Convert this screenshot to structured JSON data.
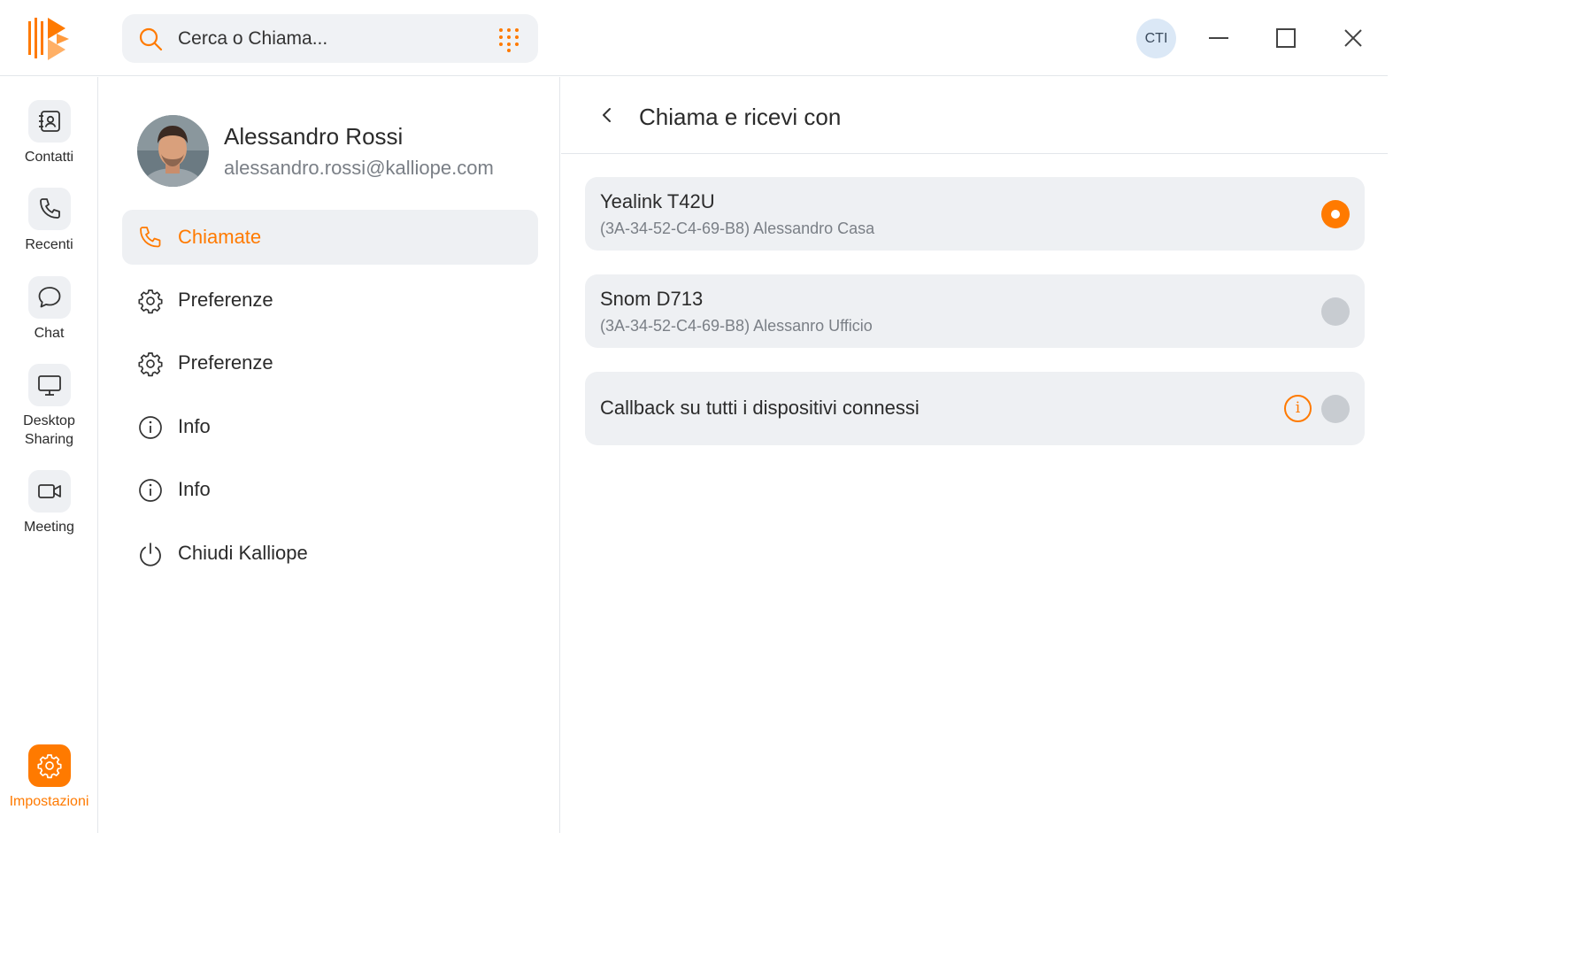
{
  "app": {
    "logo": "kalliope-logo",
    "accent_color": "#ff7a00"
  },
  "search": {
    "placeholder": "Cerca o Chiama...",
    "icon": "search-icon",
    "dialpad_icon": "dialpad-icon"
  },
  "header": {
    "badge": "CTI",
    "window_controls": [
      "minimize-icon",
      "maximize-icon",
      "close-icon"
    ]
  },
  "rail": {
    "items": [
      {
        "label": "Contatti",
        "icon": "contacts-icon"
      },
      {
        "label": "Recenti",
        "icon": "phone-icon"
      },
      {
        "label": "Chat",
        "icon": "chat-bubble-icon"
      },
      {
        "label": "Desktop\nSharing",
        "icon": "monitor-icon"
      },
      {
        "label": "Meeting",
        "icon": "video-camera-icon"
      }
    ],
    "settings": {
      "label": "Impostazioni",
      "icon": "gear-icon",
      "active": true
    }
  },
  "profile": {
    "name": "Alessandro Rossi",
    "email": "alessandro.rossi@kalliope.com"
  },
  "menu": {
    "items": [
      {
        "label": "Chiamate",
        "icon": "phone-icon",
        "active": true
      },
      {
        "label": "Preferenze",
        "icon": "gear-icon"
      },
      {
        "label": "Preferenze",
        "icon": "gear-icon"
      },
      {
        "label": "Info",
        "icon": "info-icon"
      },
      {
        "label": "Info",
        "icon": "info-icon"
      },
      {
        "label": "Chiudi Kalliope",
        "icon": "power-icon"
      }
    ]
  },
  "panel": {
    "title": "Chiama e ricevi con",
    "back_icon": "chevron-left-icon",
    "devices": [
      {
        "name": "Yealink T42U",
        "detail": "(3A-34-52-C4-69-B8) Alessandro Casa",
        "selected": true
      },
      {
        "name": "Snom D713",
        "detail": "(3A-34-52-C4-69-B8) Alessanro Ufficio",
        "selected": false
      }
    ],
    "callback": {
      "label": "Callback su tutti i dispositivi connessi",
      "info_glyph": "i",
      "selected": false
    }
  }
}
